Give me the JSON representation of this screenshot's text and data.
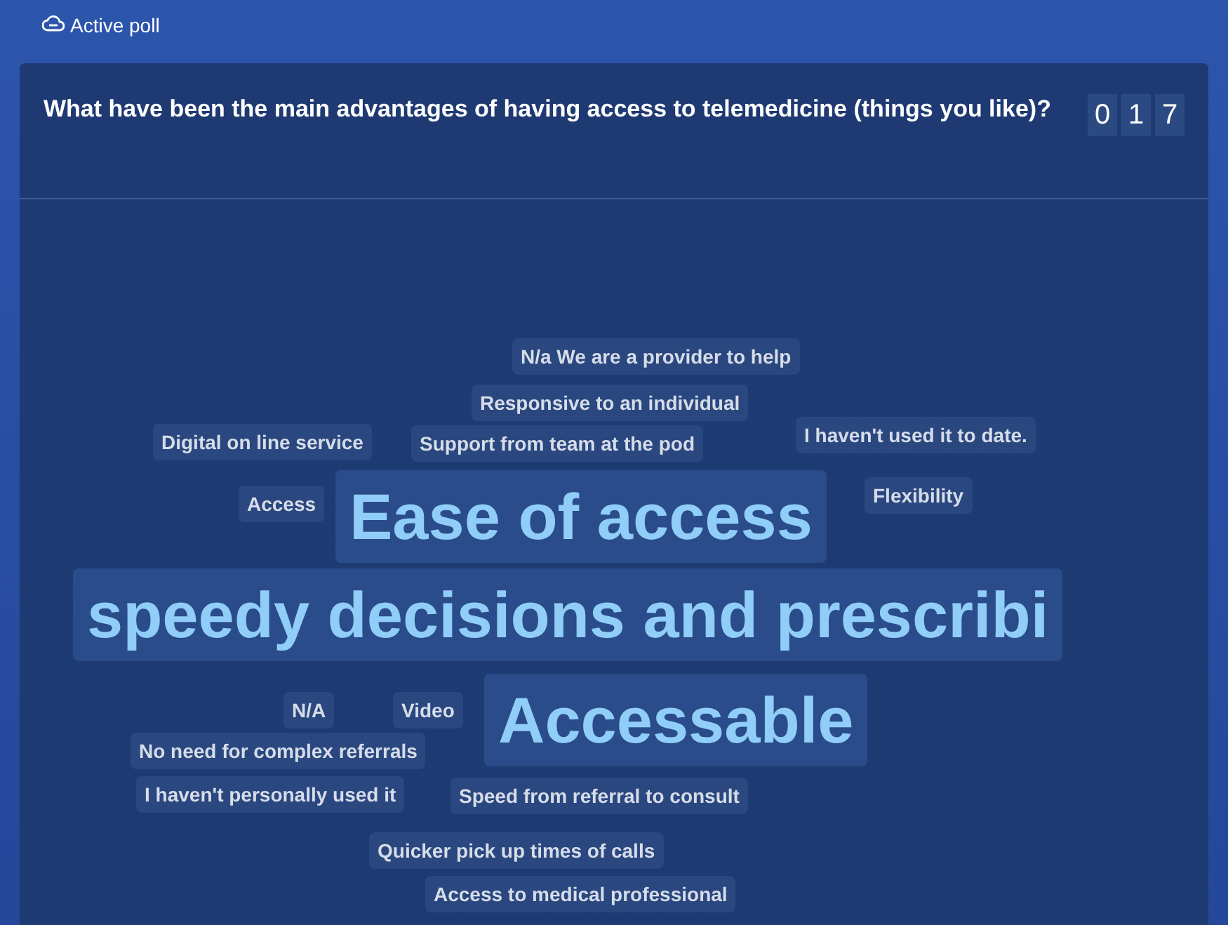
{
  "status": {
    "label": "Active poll"
  },
  "question": {
    "text": "What have been the main advantages of having access to telemedicine (things you like)?",
    "counter_digits": [
      "0",
      "1",
      "7"
    ]
  },
  "responses": [
    {
      "text": "N/a We are a provider to help",
      "kind": "minor"
    },
    {
      "text": "Responsive to an individual",
      "kind": "minor"
    },
    {
      "text": "Digital on line service",
      "kind": "minor"
    },
    {
      "text": "Support from team at the pod",
      "kind": "minor"
    },
    {
      "text": "I haven't used it to date.",
      "kind": "minor"
    },
    {
      "text": "Access",
      "kind": "minor"
    },
    {
      "text": "Ease of access",
      "kind": "major"
    },
    {
      "text": "Flexibility",
      "kind": "minor"
    },
    {
      "text": "speedy decisions and prescribi",
      "kind": "major"
    },
    {
      "text": "N/A",
      "kind": "minor"
    },
    {
      "text": "Video",
      "kind": "minor"
    },
    {
      "text": "Accessable",
      "kind": "major"
    },
    {
      "text": "No need for complex referrals",
      "kind": "minor"
    },
    {
      "text": "I haven't personally used it",
      "kind": "minor"
    },
    {
      "text": "Speed from referral to consult",
      "kind": "minor"
    },
    {
      "text": "Quicker pick up times of calls",
      "kind": "minor"
    },
    {
      "text": "Access to medical professional",
      "kind": "minor"
    }
  ]
}
